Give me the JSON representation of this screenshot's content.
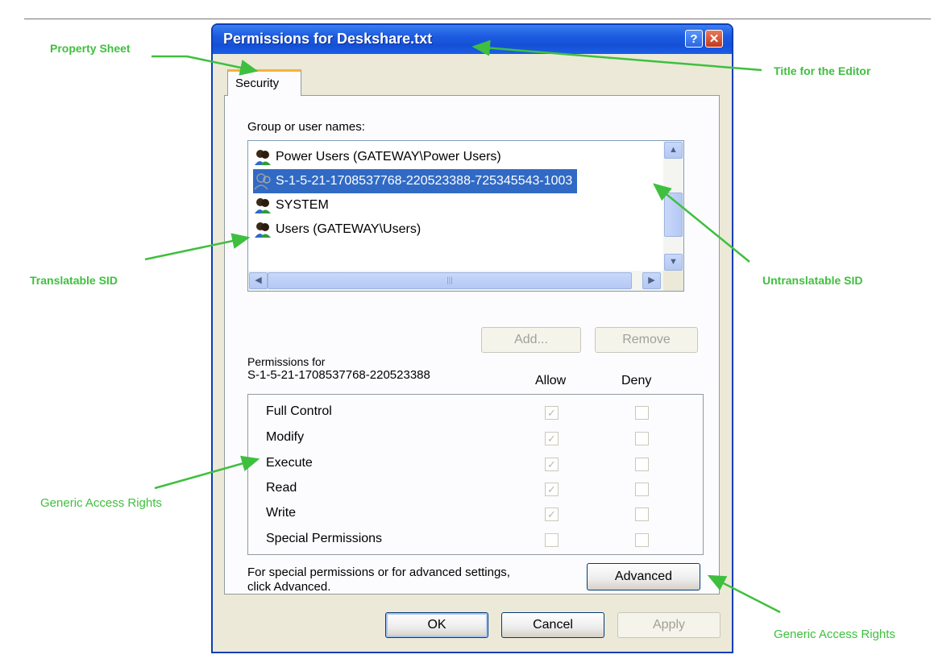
{
  "dialog": {
    "title": "Permissions for Deskshare.txt",
    "help_glyph": "?",
    "close_glyph": "✕",
    "tab": "Security"
  },
  "group": {
    "label": "Group or user names:",
    "items": [
      {
        "label": "Power Users (GATEWAY\\Power Users)",
        "icon": "group-icon",
        "selected": false
      },
      {
        "label": "S-1-5-21-1708537768-220523388-725345543-1003",
        "icon": "unknown-user-icon",
        "selected": true
      },
      {
        "label": "SYSTEM",
        "icon": "group-icon",
        "selected": false
      },
      {
        "label": "Users (GATEWAY\\Users)",
        "icon": "group-icon",
        "selected": false
      }
    ]
  },
  "buttons": {
    "add": "Add...",
    "remove": "Remove",
    "advanced": "Advanced",
    "ok": "OK",
    "cancel": "Cancel",
    "apply": "Apply"
  },
  "permissions": {
    "header_line1": "Permissions for",
    "header_line2": "S-1-5-21-1708537768-220523388",
    "allow_label": "Allow",
    "deny_label": "Deny",
    "rows": [
      {
        "name": "Full Control",
        "allow": true,
        "deny": false
      },
      {
        "name": "Modify",
        "allow": true,
        "deny": false
      },
      {
        "name": "Execute",
        "allow": true,
        "deny": false
      },
      {
        "name": "Read",
        "allow": true,
        "deny": false
      },
      {
        "name": "Write",
        "allow": true,
        "deny": false
      },
      {
        "name": "Special Permissions",
        "allow": false,
        "deny": false
      }
    ]
  },
  "advanced_note": {
    "line1": "For special permissions or for advanced settings,",
    "line2": "click Advanced."
  },
  "annotations": {
    "property_sheet": "Property Sheet",
    "title_for_editor": "Title for the Editor",
    "translatable_sid": "Translatable SID",
    "untranslatable_sid": "Untranslatable SID",
    "generic_access_rights_left": "Generic Access Rights",
    "generic_access_rights_right": "Generic Access Rights"
  },
  "colors": {
    "annotation": "#3fbf3f",
    "titlebar": "#1c5be0",
    "selection": "#316ac5"
  }
}
